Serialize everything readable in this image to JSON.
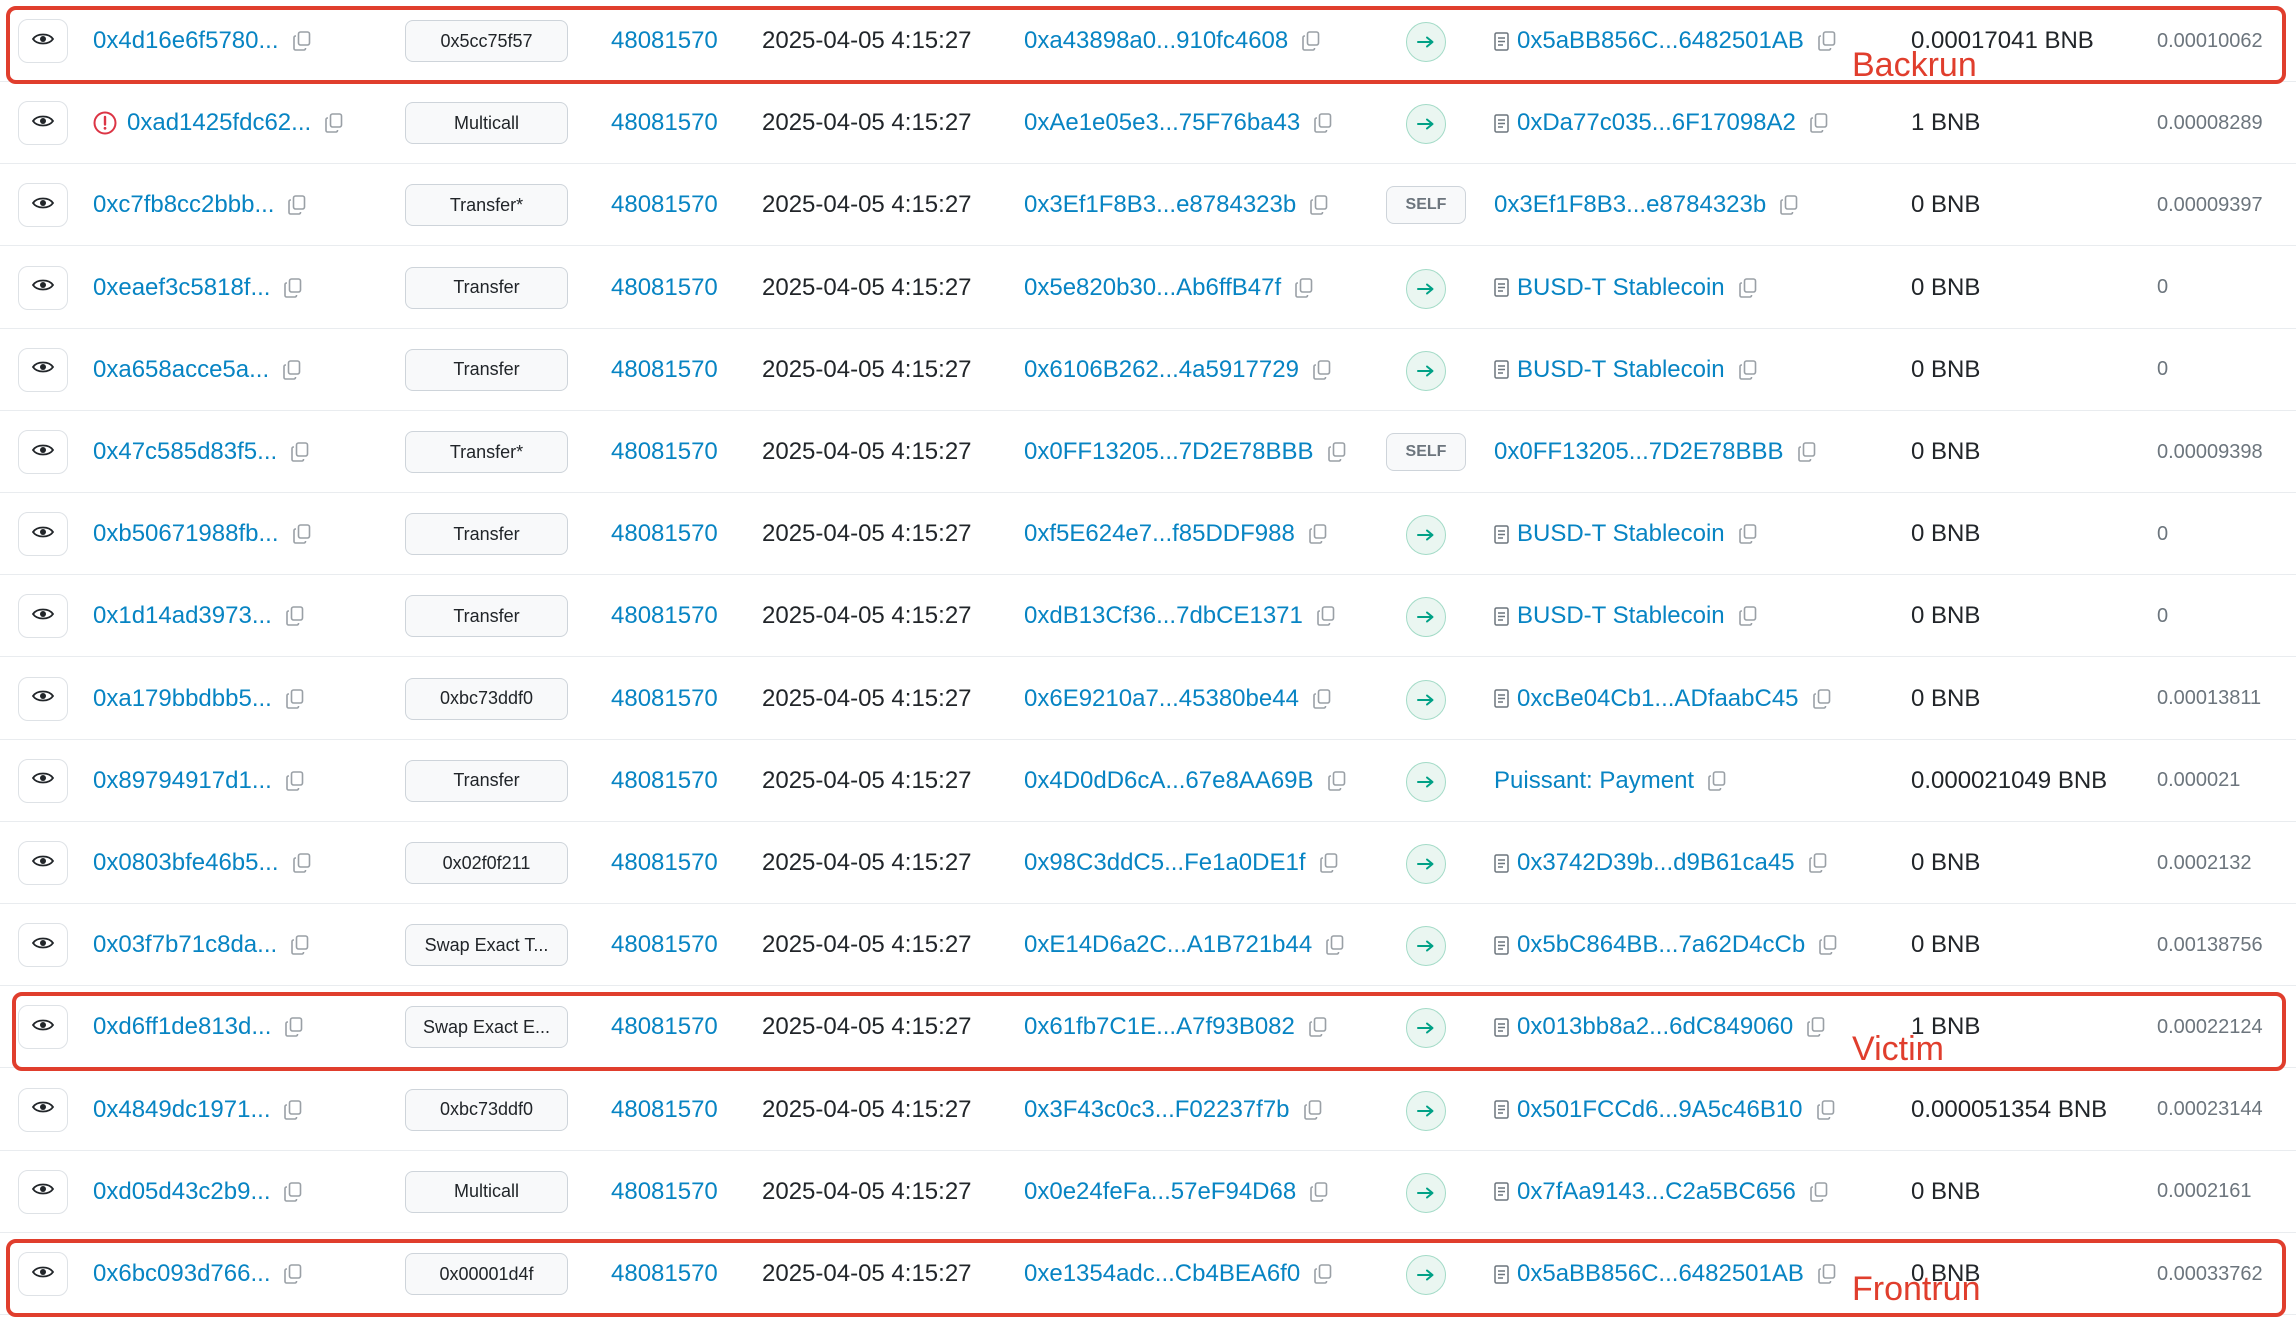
{
  "columns_visible": [
    "view",
    "txn_hash",
    "method",
    "block",
    "age",
    "from",
    "direction",
    "to",
    "amount",
    "txn_fee"
  ],
  "rows": [
    {
      "hash": "0x4d16e6f5780...",
      "error": false,
      "method": "0x5cc75f57",
      "block": "48081570",
      "age": "2025-04-05 4:15:27",
      "from": "0xa43898a0...910fc4608",
      "direction": "out",
      "to": "0x5aBB856C...6482501AB",
      "to_is_contract": true,
      "amount": "0.00017041 BNB",
      "fee": "0.00010062"
    },
    {
      "hash": "0xad1425fdc62...",
      "error": true,
      "method": "Multicall",
      "block": "48081570",
      "age": "2025-04-05 4:15:27",
      "from": "0xAe1e05e3...75F76ba43",
      "direction": "out",
      "to": "0xDa77c035...6F17098A2",
      "to_is_contract": true,
      "amount": "1 BNB",
      "fee": "0.00008289"
    },
    {
      "hash": "0xc7fb8cc2bbb...",
      "error": false,
      "method": "Transfer*",
      "block": "48081570",
      "age": "2025-04-05 4:15:27",
      "from": "0x3Ef1F8B3...e8784323b",
      "direction": "self",
      "to": "0x3Ef1F8B3...e8784323b",
      "to_is_contract": false,
      "amount": "0 BNB",
      "fee": "0.00009397"
    },
    {
      "hash": "0xeaef3c5818f...",
      "error": false,
      "method": "Transfer",
      "block": "48081570",
      "age": "2025-04-05 4:15:27",
      "from": "0x5e820b30...Ab6ffB47f",
      "direction": "out",
      "to": "BUSD-T Stablecoin",
      "to_is_contract": true,
      "amount": "0 BNB",
      "fee": "0"
    },
    {
      "hash": "0xa658acce5a...",
      "error": false,
      "method": "Transfer",
      "block": "48081570",
      "age": "2025-04-05 4:15:27",
      "from": "0x6106B262...4a5917729",
      "direction": "out",
      "to": "BUSD-T Stablecoin",
      "to_is_contract": true,
      "amount": "0 BNB",
      "fee": "0"
    },
    {
      "hash": "0x47c585d83f5...",
      "error": false,
      "method": "Transfer*",
      "block": "48081570",
      "age": "2025-04-05 4:15:27",
      "from": "0x0FF13205...7D2E78BBB",
      "direction": "self",
      "to": "0x0FF13205...7D2E78BBB",
      "to_is_contract": false,
      "amount": "0 BNB",
      "fee": "0.00009398"
    },
    {
      "hash": "0xb50671988fb...",
      "error": false,
      "method": "Transfer",
      "block": "48081570",
      "age": "2025-04-05 4:15:27",
      "from": "0xf5E624e7...f85DDF988",
      "direction": "out",
      "to": "BUSD-T Stablecoin",
      "to_is_contract": true,
      "amount": "0 BNB",
      "fee": "0"
    },
    {
      "hash": "0x1d14ad3973...",
      "error": false,
      "method": "Transfer",
      "block": "48081570",
      "age": "2025-04-05 4:15:27",
      "from": "0xdB13Cf36...7dbCE1371",
      "direction": "out",
      "to": "BUSD-T Stablecoin",
      "to_is_contract": true,
      "amount": "0 BNB",
      "fee": "0"
    },
    {
      "hash": "0xa179bbdbb5...",
      "error": false,
      "method": "0xbc73ddf0",
      "block": "48081570",
      "age": "2025-04-05 4:15:27",
      "from": "0x6E9210a7...45380be44",
      "direction": "out",
      "to": "0xcBe04Cb1...ADfaabC45",
      "to_is_contract": true,
      "amount": "0 BNB",
      "fee": "0.00013811"
    },
    {
      "hash": "0x89794917d1...",
      "error": false,
      "method": "Transfer",
      "block": "48081570",
      "age": "2025-04-05 4:15:27",
      "from": "0x4D0dD6cA...67e8AA69B",
      "direction": "out",
      "to": "Puissant: Payment",
      "to_is_contract": false,
      "amount": "0.000021049 BNB",
      "fee": "0.000021"
    },
    {
      "hash": "0x0803bfe46b5...",
      "error": false,
      "method": "0x02f0f211",
      "block": "48081570",
      "age": "2025-04-05 4:15:27",
      "from": "0x98C3ddC5...Fe1a0DE1f",
      "direction": "out",
      "to": "0x3742D39b...d9B61ca45",
      "to_is_contract": true,
      "amount": "0 BNB",
      "fee": "0.0002132"
    },
    {
      "hash": "0x03f7b71c8da...",
      "error": false,
      "method": "Swap Exact T...",
      "block": "48081570",
      "age": "2025-04-05 4:15:27",
      "from": "0xE14D6a2C...A1B721b44",
      "direction": "out",
      "to": "0x5bC864BB...7a62D4cCb",
      "to_is_contract": true,
      "amount": "0 BNB",
      "fee": "0.00138756"
    },
    {
      "hash": "0xd6ff1de813d...",
      "error": false,
      "method": "Swap Exact E...",
      "block": "48081570",
      "age": "2025-04-05 4:15:27",
      "from": "0x61fb7C1E...A7f93B082",
      "direction": "out",
      "to": "0x013bb8a2...6dC849060",
      "to_is_contract": true,
      "amount": "1 BNB",
      "fee": "0.00022124"
    },
    {
      "hash": "0x4849dc1971...",
      "error": false,
      "method": "0xbc73ddf0",
      "block": "48081570",
      "age": "2025-04-05 4:15:27",
      "from": "0x3F43c0c3...F02237f7b",
      "direction": "out",
      "to": "0x501FCCd6...9A5c46B10",
      "to_is_contract": true,
      "amount": "0.000051354 BNB",
      "fee": "0.00023144"
    },
    {
      "hash": "0xd05d43c2b9...",
      "error": false,
      "method": "Multicall",
      "block": "48081570",
      "age": "2025-04-05 4:15:27",
      "from": "0x0e24feFa...57eF94D68",
      "direction": "out",
      "to": "0x7fAa9143...C2a5BC656",
      "to_is_contract": true,
      "amount": "0 BNB",
      "fee": "0.0002161"
    },
    {
      "hash": "0x6bc093d766...",
      "error": false,
      "method": "0x00001d4f",
      "block": "48081570",
      "age": "2025-04-05 4:15:27",
      "from": "0xe1354adc...Cb4BEA6f0",
      "direction": "out",
      "to": "0x5aBB856C...6482501AB",
      "to_is_contract": true,
      "amount": "0 BNB",
      "fee": "0.00033762"
    }
  ],
  "direction_labels": {
    "self": "SELF"
  },
  "annotations": [
    {
      "label": "Backrun",
      "row": 0
    },
    {
      "label": "Victim",
      "row": 12
    },
    {
      "label": "Frontrun",
      "row": 15
    }
  ],
  "colors": {
    "link": "#0784c3",
    "annotation": "#e03e2d",
    "arrow": "#00a186",
    "error": "#dc3545"
  },
  "icons": {
    "view": "eye-icon",
    "copy": "copy-icon",
    "direction": "arrow-right-icon",
    "contract": "document-icon",
    "error": "exclamation-circle-icon"
  }
}
